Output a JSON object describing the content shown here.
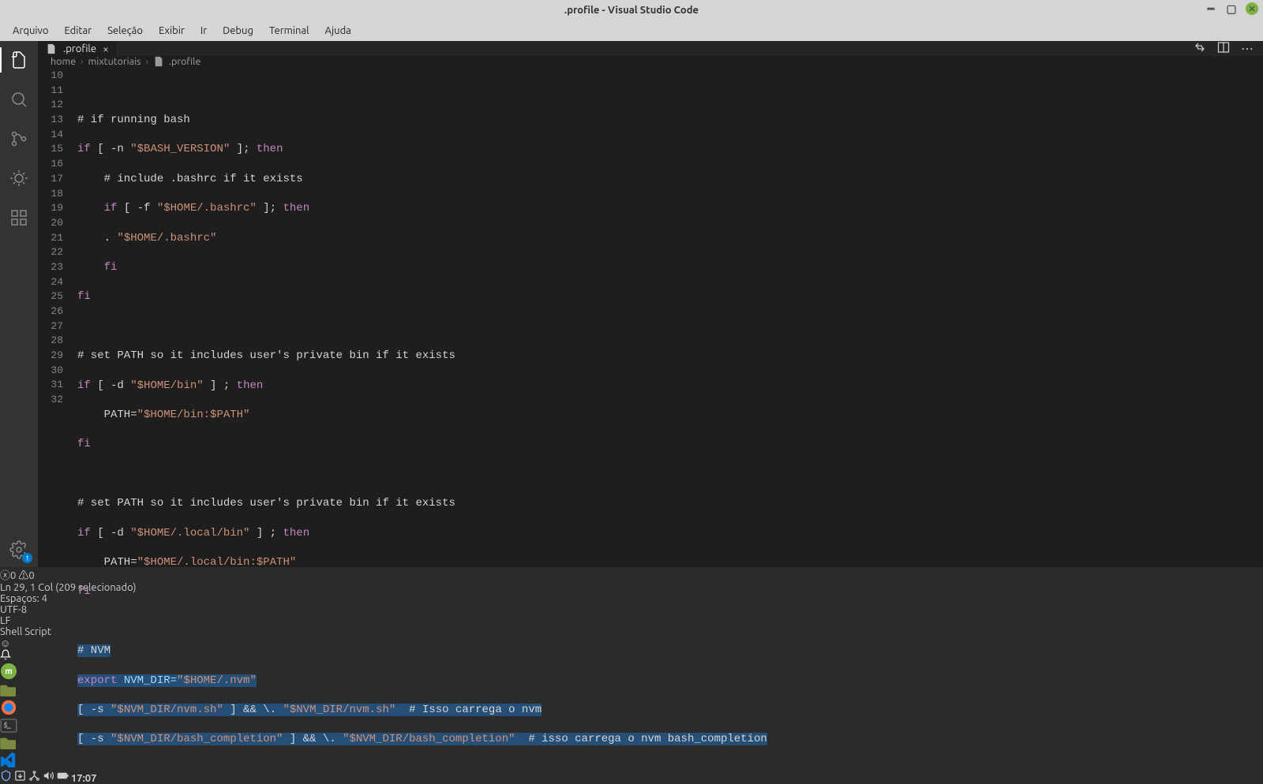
{
  "window_title": ".profile - Visual Studio Code",
  "menu": {
    "file": "Arquivo",
    "edit": "Editar",
    "selection": "Seleção",
    "view": "Exibir",
    "go": "Ir",
    "debug": "Debug",
    "terminal": "Terminal",
    "help": "Ajuda"
  },
  "tab": {
    "filename": ".profile"
  },
  "breadcrumbs": {
    "seg1": "home",
    "seg2": "mixtutoriais",
    "seg3": ".profile"
  },
  "lines": {
    "start": 10,
    "end": 32,
    "l11_comment": "# if running bash",
    "l12_if": "if",
    "l12_a": " [ -n ",
    "l12_str": "\"$BASH_VERSION\"",
    "l12_b": " ]; ",
    "l12_then": "then",
    "l13_comment": "    # include .bashrc if it exists",
    "l14_if": "    if",
    "l14_a": " [ -f ",
    "l14_str": "\"$HOME/.bashrc\"",
    "l14_b": " ]; ",
    "l14_then": "then",
    "l15_a": "    . ",
    "l15_str": "\"$HOME/.bashrc\"",
    "l16_fi": "    fi",
    "l17_fi": "fi",
    "l19_comment": "# set PATH so it includes user's private bin if it exists",
    "l20_if": "if",
    "l20_a": " [ -d ",
    "l20_str": "\"$HOME/bin\"",
    "l20_b": " ] ; ",
    "l20_then": "then",
    "l21_a": "    PATH=",
    "l21_str": "\"$HOME/bin:$PATH\"",
    "l22_fi": "fi",
    "l24_comment": "# set PATH so it includes user's private bin if it exists",
    "l25_if": "if",
    "l25_a": " [ -d ",
    "l25_str": "\"$HOME/.local/bin\"",
    "l25_b": " ] ; ",
    "l25_then": "then",
    "l26_a": "    PATH=",
    "l26_str": "\"$HOME/.local/bin:$PATH\"",
    "l27_fi": "fi",
    "l29_comment": "# NVM",
    "l30_export": "export",
    "l30_var": " NVM_DIR=",
    "l30_str": "\"$HOME/.nvm\"",
    "l31_a": "[ -s ",
    "l31_str1": "\"$NVM_DIR/nvm.sh\"",
    "l31_b": " ] && \\. ",
    "l31_str2": "\"$NVM_DIR/nvm.sh\"",
    "l31_c": "  ",
    "l31_comment": "# Isso carrega o nvm",
    "l32_a": "[ -s ",
    "l32_str1": "\"$NVM_DIR/bash_completion\"",
    "l32_b": " ] && \\. ",
    "l32_str2": "\"$NVM_DIR/bash_completion\"",
    "l32_c": "  ",
    "l32_comment": "# isso carrega o nvm bash_completion"
  },
  "status": {
    "errors": "0",
    "warnings": "0",
    "cursor": "Ln 29, 1 Col (209 selecionado)",
    "spaces": "Espaços: 4",
    "encoding": "UTF-8",
    "eol": "LF",
    "lang": "Shell Script"
  },
  "activity_badge": "1",
  "clock": "17:07"
}
